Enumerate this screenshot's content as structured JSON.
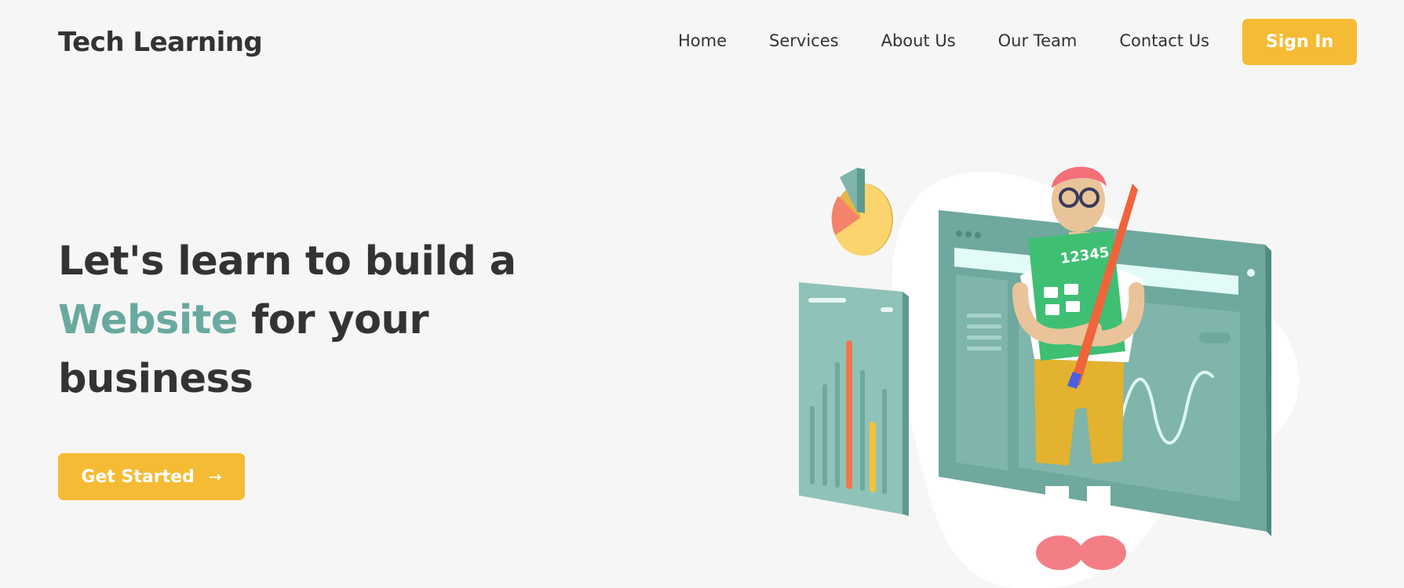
{
  "header": {
    "logo": "Tech Learning",
    "nav": [
      "Home",
      "Services",
      "About Us",
      "Our Team",
      "Contact Us"
    ],
    "signin_label": "Sign In"
  },
  "hero": {
    "line1": "Let's learn to build a",
    "line2_accent": "Website",
    "line2_rest": " for your",
    "line3": "business",
    "cta_label": "Get Started",
    "cta_icon": "arrow-right-icon",
    "calculator_text": "12345"
  },
  "colors": {
    "background": "#f6f6f6",
    "accent_teal": "#69a99f",
    "button_yellow": "#f6bb34",
    "text_dark": "#333333"
  }
}
